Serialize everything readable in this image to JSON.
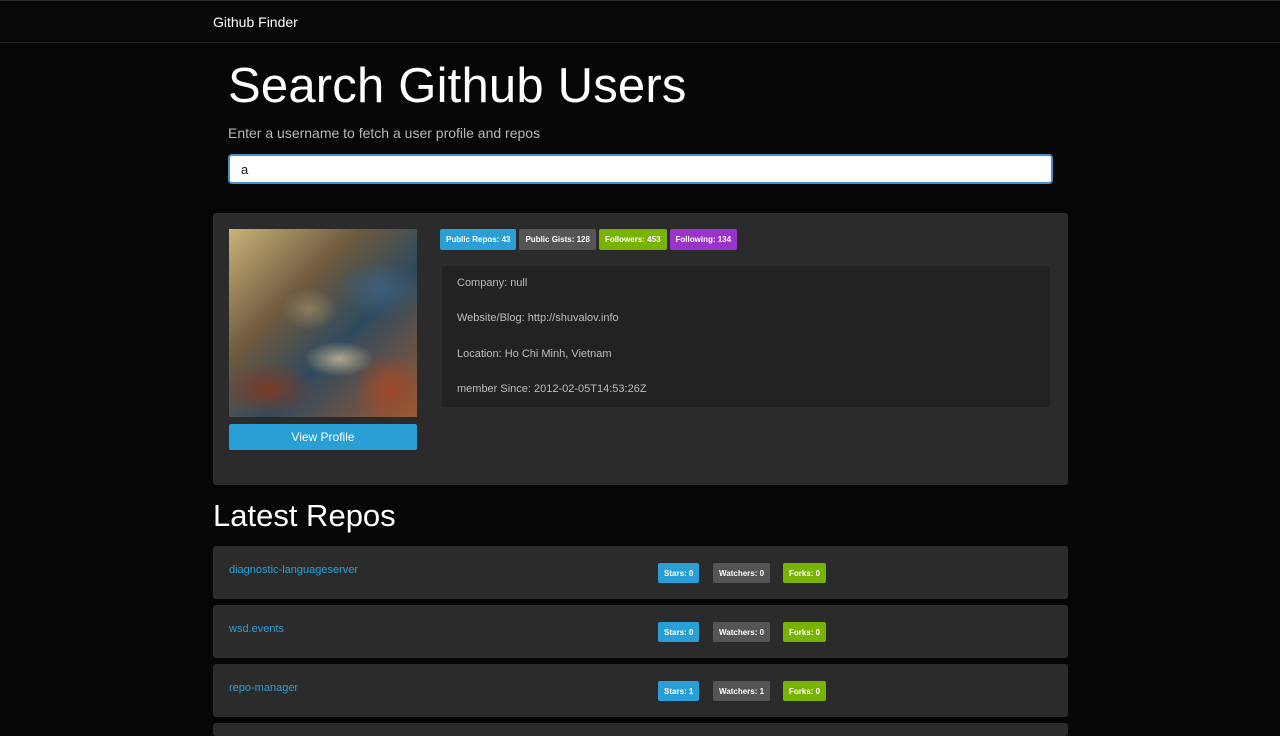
{
  "navbar": {
    "brand": "Github Finder"
  },
  "search": {
    "title": "Search Github Users",
    "lead": "Enter a username to fetch a user profile and repos",
    "value": "a",
    "placeholder": ""
  },
  "profile": {
    "avatar_alt": "",
    "view_profile_label": "View Profile",
    "badges": {
      "public_repos": "Public Repos: 43",
      "public_gists": "Public Gists: 128",
      "followers": "Followers: 453",
      "following": "Following: 134"
    },
    "info": {
      "company": "Company: null",
      "website": "Website/Blog: http://shuvalov.info",
      "location": "Location: Ho Chi Minh, Vietnam",
      "member_since": "member Since: 2012-02-05T14:53:26Z"
    }
  },
  "repos_section": {
    "title": "Latest Repos",
    "repos": [
      {
        "name": "diagnostic-languageserver",
        "stars": "Stars: 0",
        "watchers": "Watchers: 0",
        "forks": "Forks: 0"
      },
      {
        "name": "wsd.events",
        "stars": "Stars: 0",
        "watchers": "Watchers: 0",
        "forks": "Forks: 0"
      },
      {
        "name": "repo-manager",
        "stars": "Stars: 1",
        "watchers": "Watchers: 1",
        "forks": "Forks: 0"
      }
    ]
  },
  "colors": {
    "primary": "#2a9fd6",
    "dark": "#555555",
    "success": "#77b300",
    "purple": "#9933cc",
    "card": "#2b2b2b",
    "background": "#060606"
  }
}
